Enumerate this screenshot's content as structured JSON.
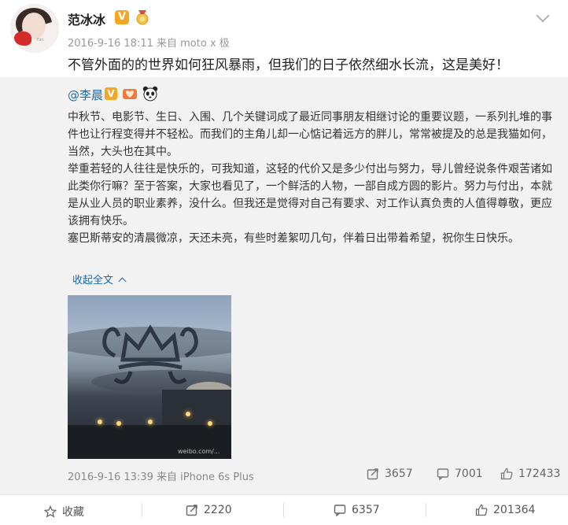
{
  "post": {
    "author_name": "范冰冰",
    "meta_text": "2016-9-16 18:11 来自 moto x 极",
    "content": "不管外面的的世界如何狂风暴雨，但我们的日子依然细水长流，这是美好！",
    "colors": {
      "link": "#1d69a8",
      "badge": "#f5a623",
      "repost_bg": "#f2f2f2"
    }
  },
  "repost": {
    "user": "@李晨",
    "paragraphs": [
      "中秋节、电影节、生日、入围、几个关键词成了最近同事朋友相继讨论的重要议题，一系列扎堆的事件也让行程变得并不轻松。而我们的主角儿却一心惦记着远方的胖儿，常常被提及的总是我猫如何，当然，大头也在其中。",
      "举重若轻的人往往是快乐的，可我知道，这轻的代价又是多少付出与努力，导儿曾经说条件艰苦诸如此类你行嘛？至于答案，大家也看见了，一个鲜活的人物，一部自成方圆的影片。努力与付出，本就是从业人员的职业素养，没什么。但我还是觉得对自己有要求、对工作认真负责的人值得尊敬，更应该拥有快乐。",
      "塞巴斯蒂安的清晨微凉，天还未亮，有些时差絮叨几句，伴着日出带着希望，祝你生日快乐。"
    ],
    "collapse_label": "收起全文",
    "image_watermark": "weibo.com/...",
    "time": "2016-9-16 13:39 来自 iPhone 6s Plus",
    "reposts": "3657",
    "comments": "7001",
    "likes": "172433"
  },
  "actions": {
    "favorite_label": "收藏",
    "reposts": "2220",
    "comments": "6357",
    "likes": "201364"
  }
}
